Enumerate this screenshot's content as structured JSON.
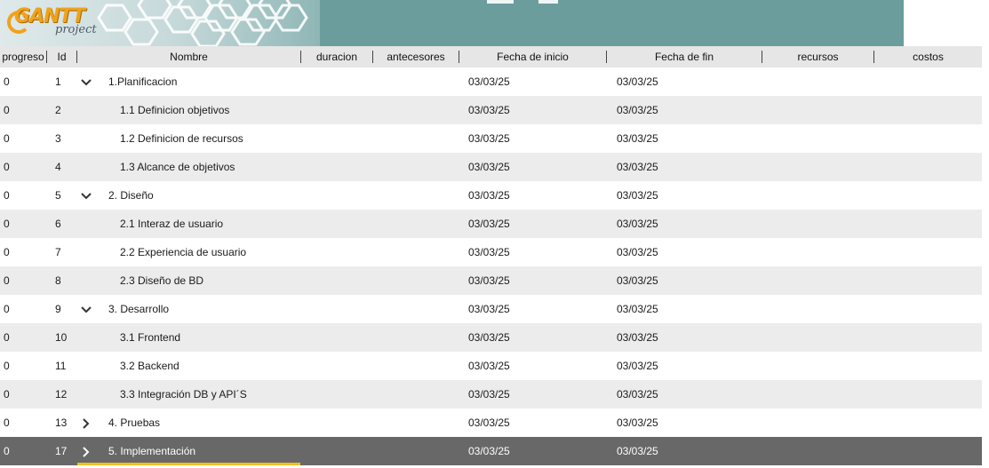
{
  "app": {
    "logo_word": "GANTT",
    "logo_sub": "project"
  },
  "columns": [
    "progreso",
    "Id",
    "Nombre",
    "duracion",
    "antecesores",
    "Fecha de inicio",
    "Fecha de fin",
    "recursos",
    "costos"
  ],
  "tasks": [
    {
      "progress": "0",
      "id": "1",
      "name": "1.Planificacion",
      "toggle": "expanded",
      "start": "03/03/25",
      "end": "03/03/25"
    },
    {
      "progress": "0",
      "id": "2",
      "name": "1.1 Definicion objetivos",
      "toggle": "",
      "start": "03/03/25",
      "end": "03/03/25"
    },
    {
      "progress": "0",
      "id": "3",
      "name": "1.2 Definicion de recursos",
      "toggle": "",
      "start": "03/03/25",
      "end": "03/03/25"
    },
    {
      "progress": "0",
      "id": "4",
      "name": "1.3 Alcance de objetivos",
      "toggle": "",
      "start": "03/03/25",
      "end": "03/03/25"
    },
    {
      "progress": "0",
      "id": "5",
      "name": "2. Diseño",
      "toggle": "expanded",
      "start": "03/03/25",
      "end": "03/03/25"
    },
    {
      "progress": "0",
      "id": "6",
      "name": "2.1 Interaz de usuario",
      "toggle": "",
      "start": "03/03/25",
      "end": "03/03/25"
    },
    {
      "progress": "0",
      "id": "7",
      "name": "2.2 Experiencia de usuario",
      "toggle": "",
      "start": "03/03/25",
      "end": "03/03/25"
    },
    {
      "progress": "0",
      "id": "8",
      "name": "2.3 Diseño de BD",
      "toggle": "",
      "start": "03/03/25",
      "end": "03/03/25"
    },
    {
      "progress": "0",
      "id": "9",
      "name": "3. Desarrollo",
      "toggle": "expanded",
      "start": "03/03/25",
      "end": "03/03/25"
    },
    {
      "progress": "0",
      "id": "10",
      "name": "3.1 Frontend",
      "toggle": "",
      "start": "03/03/25",
      "end": "03/03/25"
    },
    {
      "progress": "0",
      "id": "11",
      "name": "3.2 Backend",
      "toggle": "",
      "start": "03/03/25",
      "end": "03/03/25"
    },
    {
      "progress": "0",
      "id": "12",
      "name": "3.3 Integración DB y API´S",
      "toggle": "",
      "start": "03/03/25",
      "end": "03/03/25"
    },
    {
      "progress": "0",
      "id": "13",
      "name": "4. Pruebas",
      "toggle": "collapsed",
      "start": "03/03/25",
      "end": "03/03/25"
    },
    {
      "progress": "0",
      "id": "17",
      "name": "5. Implementación",
      "toggle": "collapsed",
      "start": "03/03/25",
      "end": "03/03/25",
      "selected": true
    }
  ],
  "colors": {
    "banner": "#6a9d9c",
    "logo_orange": "#f0a21a",
    "header_bg": "#e6e6e6",
    "row_alt": "#ececec",
    "selected_row": "#686868",
    "focus_line": "#f0c020"
  }
}
